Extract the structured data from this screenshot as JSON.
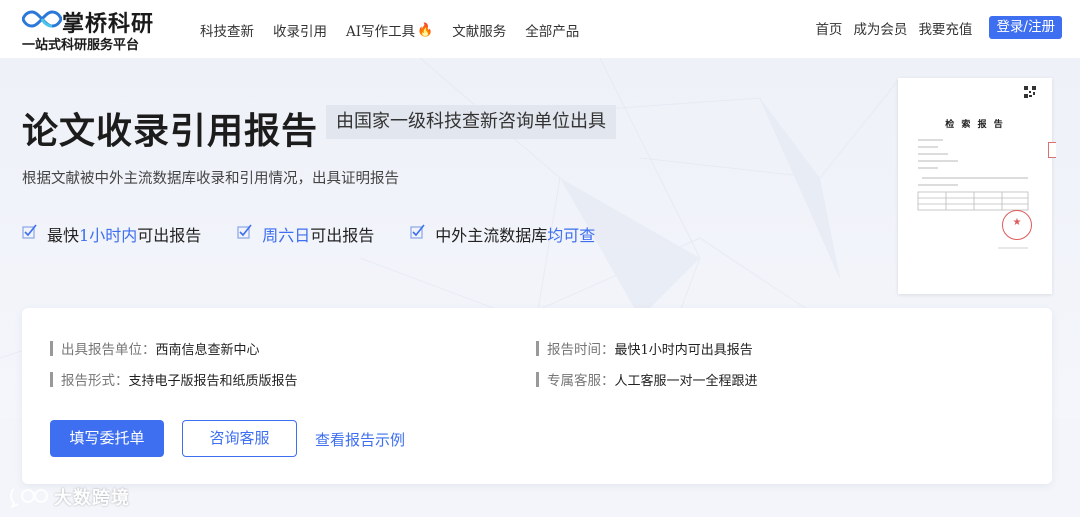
{
  "nav": {
    "logo_name": "掌桥科研",
    "logo_tagline": "一站式科研服务平台",
    "menu": [
      {
        "label": "科技查新"
      },
      {
        "label": "收录引用"
      },
      {
        "label": "AI写作工具",
        "icon": "fire-icon"
      },
      {
        "label": "文献服务"
      },
      {
        "label": "全部产品"
      }
    ],
    "right_links": [
      {
        "label": "首页"
      },
      {
        "label": "成为会员"
      },
      {
        "label": "我要充值"
      }
    ],
    "login_label": "登录/注册"
  },
  "hero": {
    "title": "论文收录引用报告",
    "subtitle": "由国家一级科技查新咨询单位出具",
    "description": "根据文献被中外主流数据库收录和引用情况，出具证明报告",
    "features": [
      {
        "pre": "最快",
        "highlight": "1小时内",
        "post": "可出报告"
      },
      {
        "pre": "",
        "highlight": "周六日",
        "post": "可出报告"
      },
      {
        "pre": "中外主流数据库",
        "highlight": "均可查",
        "post": ""
      }
    ],
    "sample_report_title": "检 索 报 告"
  },
  "info": {
    "unit_label": "出具报告单位：",
    "unit_value": "西南信息查新中心",
    "time_label": "报告时间：",
    "time_value": "最快1小时内可出具报告",
    "format_label": "报告形式：",
    "format_value": "支持电子版报告和纸质版报告",
    "service_label": "专属客服：",
    "service_value": "人工客服一对一全程跟进"
  },
  "actions": {
    "primary_label": "填写委托单",
    "consult_label": "咨询客服",
    "sample_label": "查看报告示例"
  },
  "watermark": {
    "text": "大数跨境"
  },
  "colors": {
    "accent": "#3e6ff0",
    "fire": "#ff5a1f",
    "stamp": "#d84040"
  }
}
